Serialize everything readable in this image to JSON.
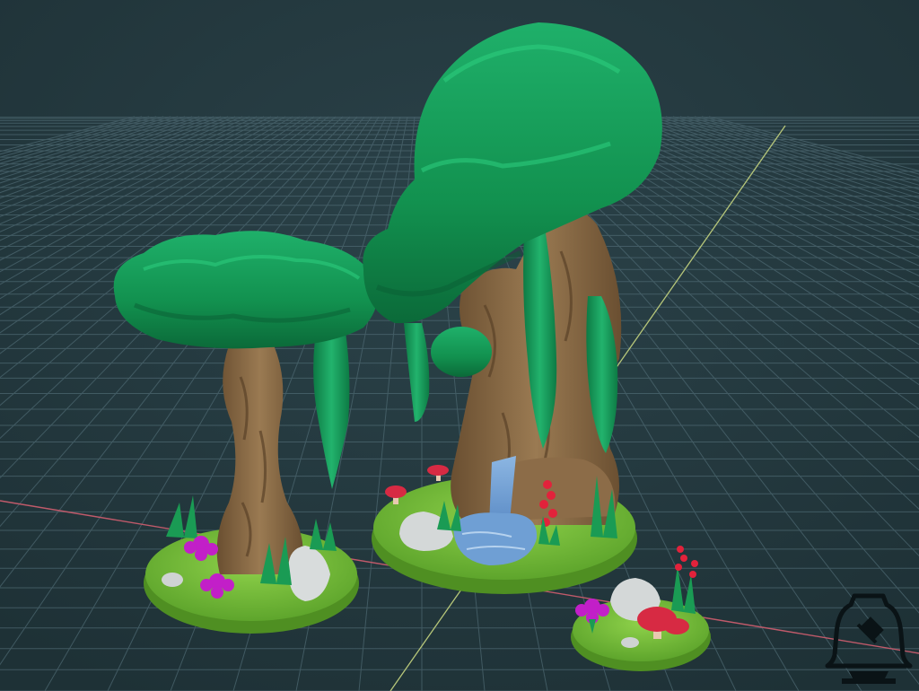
{
  "viewport": {
    "background": "#22373d",
    "grid_color": "#4c6770",
    "x_axis_color": "#c05a6a",
    "y_axis_color": "#b7c77a"
  },
  "models": [
    {
      "name": "mushroom-tree-small",
      "canopy_color": "#139457",
      "trunk_color": "#8a6a45"
    },
    {
      "name": "waterfall-tree-large",
      "canopy_color": "#139457",
      "trunk_color": "#8a6a45",
      "water_color": "#6f9fd4"
    },
    {
      "name": "flower-base",
      "base_color": "#78c23b"
    }
  ],
  "icons": {
    "logo": "bell-hammer-anvil-icon"
  }
}
